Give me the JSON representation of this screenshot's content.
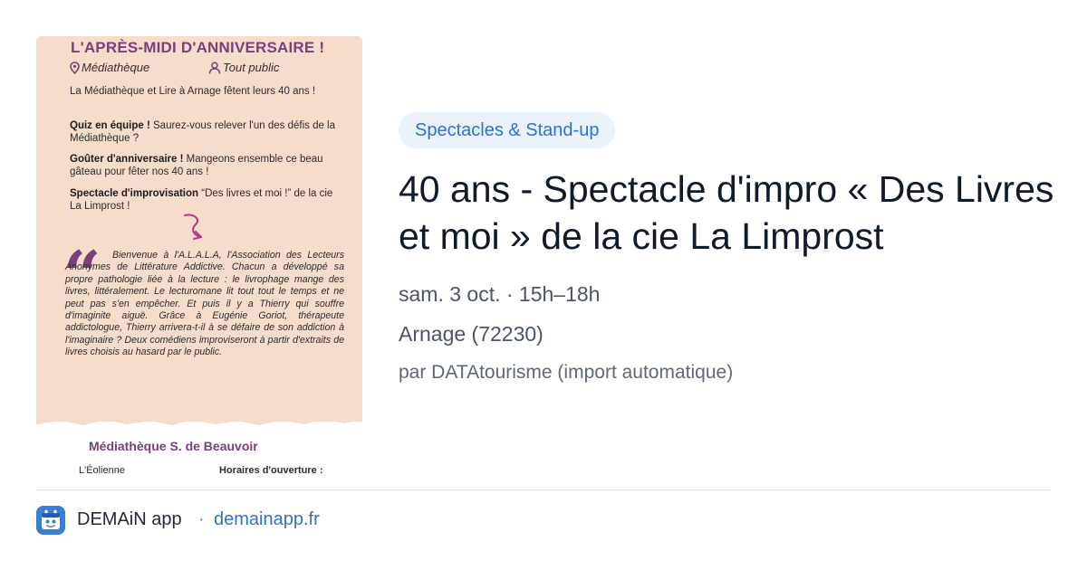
{
  "card": {
    "category": "Spectacles & Stand-up",
    "title": "40 ans - Spectacle d'impro « Des Livres et moi » de la cie La Limprost",
    "datetime": "sam. 3 oct. · 15h–18h",
    "location": "Arnage (72230)",
    "source": "par DATAtourisme (import automatique)"
  },
  "poster": {
    "title": "L'APRÈS-MIDI D'ANNIVERSAIRE !",
    "location": "Médiathèque",
    "audience": "Tout public",
    "intro": "La Médiathèque et Lire à Arnage fêtent leurs 40 ans !",
    "quiz_label": "Quiz en équipe !",
    "quiz_text": " Saurez-vous relever l'un des défis de la Médiathèque ?",
    "gouter_label": "Goûter d'anniversaire !",
    "gouter_text": " Mangeons ensemble ce beau gâteau pour fêter nos 40 ans !",
    "show_label": "Spectacle d'improvisation",
    "show_text": " “Des livres et moi !” de la cie La Limprost !",
    "quote": "Bienvenue à l'A.L.A.L.A, l'Association des Lecteurs Anonymes de Littérature Addictive. Chacun a développé sa propre pathologie liée à la lecture : le livrophage mange des livres, littéralement. Le lecturomane lit tout tout le temps et ne peut pas s'en empêcher. Et puis il y a Thierry qui souffre d'imaginite aiguë. Grâce à Eugénie Goriot, thérapeute addictologue, Thierry arrivera-t-il à se défaire de son addiction à l'imaginaire ? Deux comédiens improviseront à partir d'extraits de livres choisis au hasard par le public.",
    "venue": "Médiathèque S. de Beauvoir",
    "footer_left": "L'Éolienne",
    "footer_right": "Horaires d'ouverture :"
  },
  "footer": {
    "app_name": "DEMAiN app",
    "separator": "·",
    "url": "demainapp.fr"
  },
  "colors": {
    "accent": "#2f72c8",
    "category_bg": "#eaf2fc",
    "poster_bg": "#f6dccb",
    "poster_accent": "#7a3f7c",
    "app_icon": "#3a7fd5"
  },
  "icons": {
    "poster_location": "map-pin-icon",
    "poster_audience": "person-icon",
    "poster_arrow": "curved-arrow-icon",
    "app": "demain-app-icon"
  }
}
